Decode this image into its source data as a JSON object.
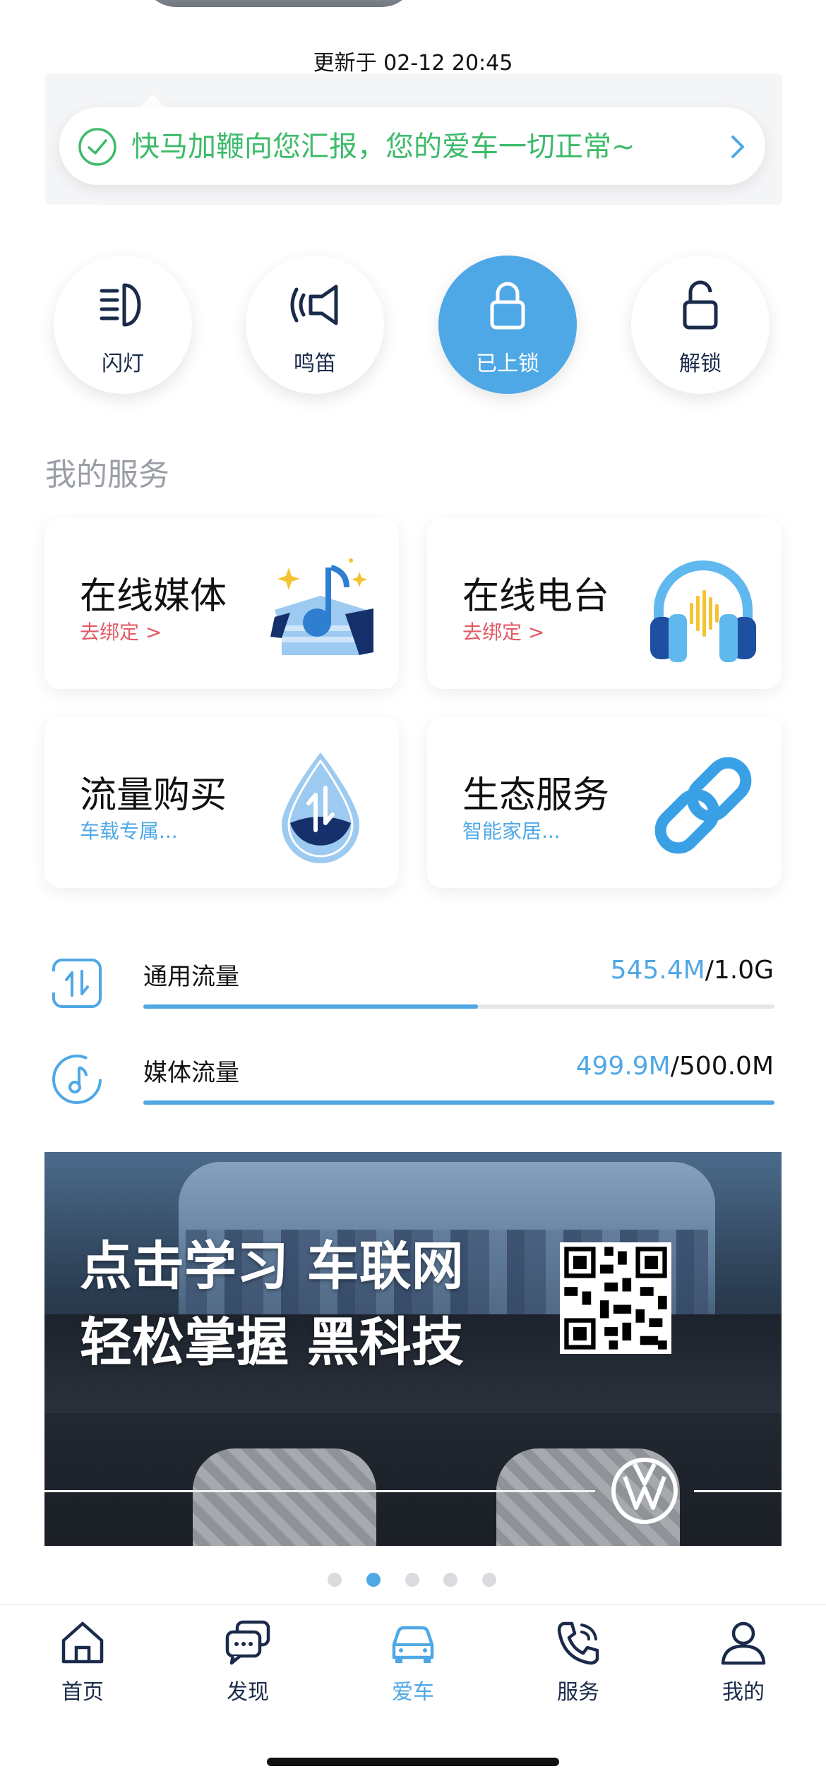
{
  "update_time": "更新于 02-12 20:45",
  "status": {
    "message": "快马加鞭向您汇报，您的爱车一切正常~",
    "color": "#3dbb6a"
  },
  "quick_actions": [
    {
      "label": "闪灯",
      "icon": "headlight-icon",
      "active": false
    },
    {
      "label": "鸣笛",
      "icon": "horn-icon",
      "active": false
    },
    {
      "label": "已上锁",
      "icon": "lock-icon",
      "active": true
    },
    {
      "label": "解锁",
      "icon": "unlock-icon",
      "active": false
    }
  ],
  "section_title": "我的服务",
  "services": [
    {
      "title": "在线媒体",
      "subtitle": "去绑定 >",
      "subtitle_color": "#e25a66",
      "icon": "music-box-icon"
    },
    {
      "title": "在线电台",
      "subtitle": "去绑定 >",
      "subtitle_color": "#e25a66",
      "icon": "headphones-icon"
    },
    {
      "title": "流量购买",
      "subtitle": "车载专属...",
      "subtitle_color": "#4fa8e6",
      "icon": "data-drop-icon"
    },
    {
      "title": "生态服务",
      "subtitle": "智能家居...",
      "subtitle_color": "#4fa8e6",
      "icon": "chain-link-icon"
    }
  ],
  "traffic": [
    {
      "label": "通用流量",
      "used": "545.4M",
      "total": "/1.0G",
      "fraction": 0.53
    },
    {
      "label": "媒体流量",
      "used": "499.9M",
      "total": "/500.0M",
      "fraction": 0.9998
    }
  ],
  "banner": {
    "line1": "点击学习 车联网",
    "line2": "轻松掌握 黑科技"
  },
  "carousel": {
    "count": 5,
    "active_index": 1
  },
  "tabs": [
    {
      "label": "首页",
      "icon": "home-icon",
      "active": false
    },
    {
      "label": "发现",
      "icon": "chat-bubbles-icon",
      "active": false
    },
    {
      "label": "爱车",
      "icon": "car-icon",
      "active": true
    },
    {
      "label": "服务",
      "icon": "phone-icon",
      "active": false
    },
    {
      "label": "我的",
      "icon": "profile-icon",
      "active": false
    }
  ],
  "colors": {
    "accent": "#4fa8e6",
    "success": "#3dbb6a",
    "link_red": "#e25a66",
    "icon_navy": "#1a2a4a"
  }
}
